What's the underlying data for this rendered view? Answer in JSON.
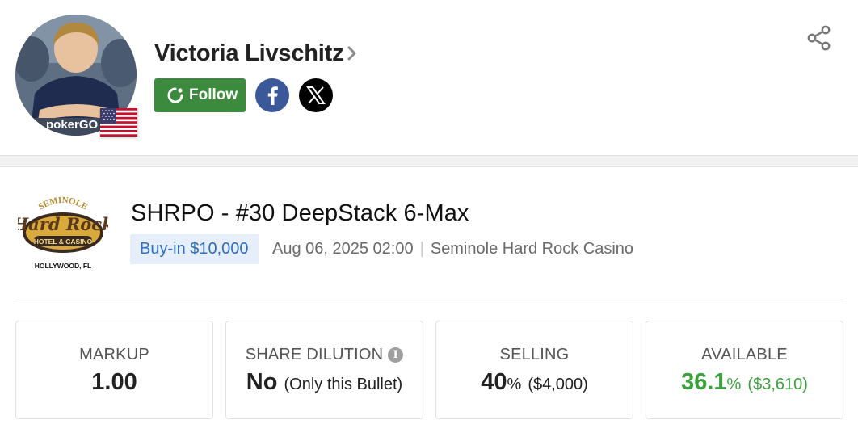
{
  "player": {
    "name": "Victoria Livschitz",
    "avatar_watermark": "pokerGO",
    "flag": "us-flag-icon",
    "follow_label": "Follow",
    "social": [
      "facebook-icon",
      "x-icon"
    ]
  },
  "event": {
    "logo_text_top": "SEMINOLE",
    "logo_text_main": "Hard Rock",
    "logo_text_band": "HOTEL & CASINO",
    "logo_text_bottom": "HOLLYWOOD, FL",
    "title": "SHRPO - #30 DeepStack 6-Max",
    "buyin": "Buy-in $10,000",
    "datetime": "Aug 06, 2025 02:00",
    "separator": "|",
    "venue": "Seminole Hard Rock Casino"
  },
  "stats": {
    "markup": {
      "label": "MARKUP",
      "value": "1.00"
    },
    "dilution": {
      "label": "SHARE DILUTION",
      "info": "i",
      "value": "No",
      "note": "(Only this Bullet)"
    },
    "selling": {
      "label": "SELLING",
      "value": "40",
      "unit": "%",
      "amount": "($4,000)"
    },
    "available": {
      "label": "AVAILABLE",
      "value": "36.1",
      "unit": "%",
      "amount": "($3,610)"
    }
  },
  "colors": {
    "follow_green": "#3b8a3e",
    "available_green": "#3aa13d",
    "buyin_blue": "#2f6dc0",
    "buyin_bg": "#e5eef9",
    "facebook_blue": "#3b5998"
  }
}
